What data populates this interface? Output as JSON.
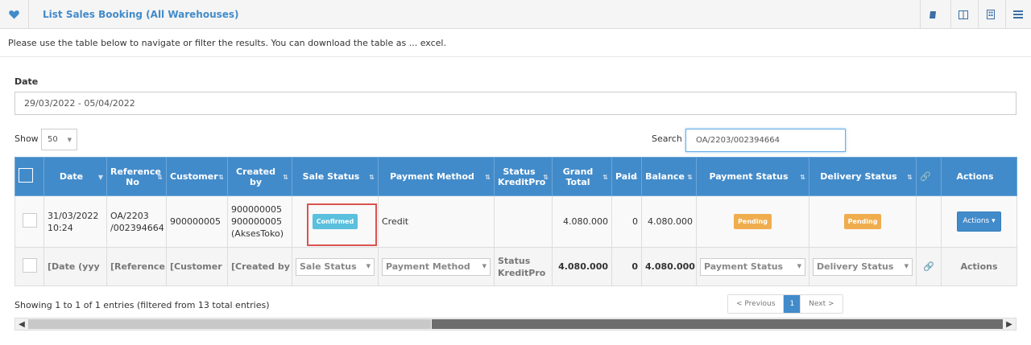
{
  "header": {
    "title": "List Sales Booking (All Warehouses)",
    "icons": [
      "heart-icon",
      "book-icon",
      "columns-icon",
      "building-icon",
      "list-icon"
    ]
  },
  "intro_text": "Please use the table below to navigate or filter the results. You can download the table as ... excel.",
  "date_filter": {
    "label": "Date",
    "value": "29/03/2022 - 05/04/2022"
  },
  "length": {
    "label": "Show",
    "value": "50"
  },
  "search": {
    "label": "Search",
    "value": "OA/2203/002394664"
  },
  "table": {
    "columns": [
      "Date",
      "Reference No",
      "Customer",
      "Created by",
      "Sale Status",
      "Payment Method",
      "Status KreditPro",
      "Grand Total",
      "Paid",
      "Balance",
      "Payment Status",
      "Delivery Status",
      "Actions"
    ],
    "row": {
      "date": "31/03/2022 10:24",
      "reference": "OA/2203 /002394664",
      "customer": "900000005",
      "created_by": "900000005 900000005 (AksesToko)",
      "sale_status": "Confirmed",
      "payment_method": "Credit",
      "status_kreditpro": "",
      "grand_total": "4.080.000",
      "paid": "0",
      "balance": "4.080.000",
      "payment_status": "Pending",
      "delivery_status": "Pending",
      "actions": "Actions"
    },
    "footer": {
      "date": "[Date (yyy",
      "reference": "[Reference",
      "customer": "[Customer",
      "created_by": "[Created by",
      "sale_status": "Sale Status",
      "payment_method": "Payment Method",
      "status_kreditpro": "Status KreditPro",
      "grand_total": "4.080.000",
      "paid": "0",
      "balance": "4.080.000",
      "payment_status": "Payment Status",
      "delivery_status": "Delivery Status",
      "actions": "Actions"
    }
  },
  "info_text": "Showing 1 to 1 of 1 entries (filtered from 13 total entries)",
  "pagination": {
    "previous": "< Previous",
    "current": "1",
    "next": "Next >"
  }
}
